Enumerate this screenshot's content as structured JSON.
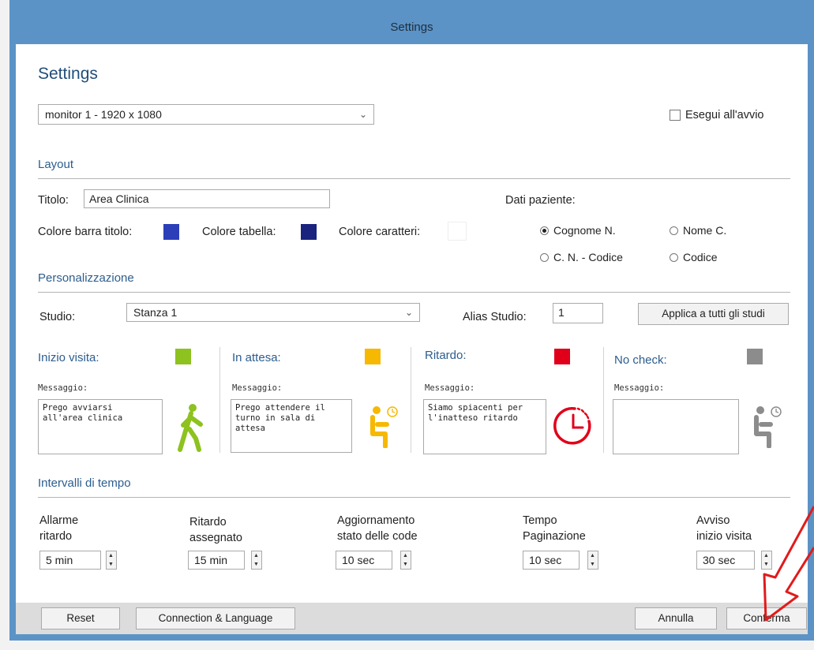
{
  "window": {
    "title": "Settings"
  },
  "header": {
    "heading": "Settings",
    "monitor_select": "monitor 1 - 1920 x 1080",
    "autostart_label": "Esegui all'avvio"
  },
  "layout": {
    "section_label": "Layout",
    "title_label": "Titolo:",
    "title_value": "Area Clinica",
    "title_bar_color_label": "Colore barra titolo:",
    "table_color_label": "Colore tabella:",
    "text_color_label": "Colore caratteri:",
    "colors": {
      "title_bar": "#2c3eb8",
      "table": "#1a237e",
      "text": "#ffffff"
    },
    "patient_data_label": "Dati paziente:",
    "patient_options": [
      {
        "label": "Cognome N.",
        "selected": true
      },
      {
        "label": "Nome C.",
        "selected": false
      },
      {
        "label": "C. N. - Codice",
        "selected": false
      },
      {
        "label": "Codice",
        "selected": false
      }
    ]
  },
  "custom": {
    "section_label": "Personalizzazione",
    "studio_label": "Studio:",
    "studio_value": "Stanza 1",
    "alias_label": "Alias Studio:",
    "alias_value": "1",
    "apply_all_label": "Applica a tutti gli studi",
    "message_label": "Messaggio:",
    "states": [
      {
        "title": "Inizio visita:",
        "color": "#8dc21f",
        "message_line1": "Prego avviarsi",
        "message_line2": "all'area clinica",
        "icon": "walking-person-icon"
      },
      {
        "title": "In attesa:",
        "color": "#f6b800",
        "message_line1": "Prego attendere il",
        "message_line2": "turno in sala di attesa",
        "icon": "seated-waiting-icon"
      },
      {
        "title": "Ritardo:",
        "color": "#e1001a",
        "message_line1": "Siamo spiacenti per",
        "message_line2": "l'inatteso ritardo",
        "icon": "clock-icon"
      },
      {
        "title": "No check:",
        "color": "#8c8c8c",
        "message_line1": "",
        "message_line2": "",
        "icon": "seated-waiting-gray-icon"
      }
    ]
  },
  "intervals": {
    "section_label": "Intervalli di tempo",
    "items": [
      {
        "line1": "Allarme",
        "line2": "ritardo",
        "value": "5 min"
      },
      {
        "line1": "Ritardo",
        "line2": "assegnato",
        "value": "15 min"
      },
      {
        "line1": "Aggiornamento",
        "line2": "stato delle code",
        "value": "10 sec"
      },
      {
        "line1": "Tempo",
        "line2": "Paginazione",
        "value": "10 sec"
      },
      {
        "line1": "Avviso",
        "line2": "inizio visita",
        "value": "30 sec"
      }
    ]
  },
  "footer": {
    "reset": "Reset",
    "connection": "Connection & Language",
    "cancel": "Annulla",
    "confirm": "Conferma"
  }
}
